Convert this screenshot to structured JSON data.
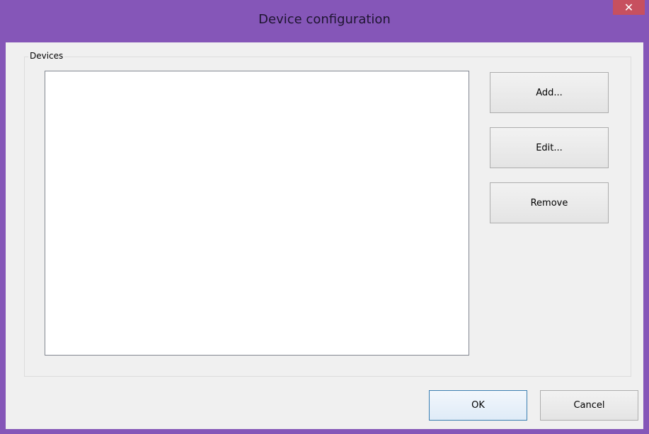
{
  "window": {
    "title": "Device configuration",
    "close_glyph": "✕"
  },
  "devices_group": {
    "label": "Devices",
    "items": []
  },
  "buttons": {
    "add": "Add...",
    "edit": "Edit...",
    "remove": "Remove",
    "ok": "OK",
    "cancel": "Cancel"
  },
  "colors": {
    "frame": "#8556b8",
    "close_button": "#c7505f",
    "dialog_background": "#f0f0f0",
    "default_button_border": "#3c7fb1"
  },
  "icons": {
    "close": "close-icon"
  }
}
